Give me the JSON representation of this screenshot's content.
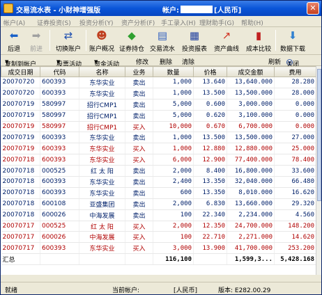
{
  "window": {
    "title": "交易流水表 - 小财神增强版",
    "account_label": "帐户:",
    "account_currency": "[人民币]",
    "close_glyph": "✕"
  },
  "menu": [
    "帐户(A)",
    "证券投资(S)",
    "投资分析(Y)",
    "资产分析(F)",
    "手工录入(H)",
    "理财助手(G)",
    "帮助(H)"
  ],
  "toolbar": {
    "back": "后退",
    "forward": "前进",
    "switch_account": "切换账户",
    "account_overview": "账户概况",
    "holdings": "证券持仓",
    "trade_log": "交易流水",
    "invest_report": "投资报表",
    "asset_curve": "资产曲线",
    "cost_compare": "成本比较",
    "data_download": "数据下载"
  },
  "subbar": {
    "copy_account": "复制到帐户",
    "stock_activity": "股票活动",
    "fund_activity": "资金活动",
    "edit": "修改",
    "delete": "删除",
    "clear": "清除",
    "refresh": "刷新",
    "close": "关闭",
    "dropdown_glyph": "▼"
  },
  "table": {
    "headers": [
      "成交日期",
      "代码",
      "名称",
      "业务",
      "数量",
      "价格",
      "成交金额",
      "费用"
    ],
    "rows": [
      {
        "date": "20070720",
        "code": "600393",
        "name": "东华实业",
        "side": "卖出",
        "qty": "1,000",
        "price": "13.640",
        "amount": "13,640.000",
        "fee": "28.280",
        "type": "sell"
      },
      {
        "date": "20070720",
        "code": "600393",
        "name": "东华实业",
        "side": "卖出",
        "qty": "1,000",
        "price": "13.500",
        "amount": "13,500.000",
        "fee": "28.000",
        "type": "sell"
      },
      {
        "date": "20070719",
        "code": "580997",
        "name": "招行CMP1",
        "side": "卖出",
        "qty": "5,000",
        "price": "0.600",
        "amount": "3,000.000",
        "fee": "0.000",
        "type": "sell"
      },
      {
        "date": "20070719",
        "code": "580997",
        "name": "招行CMP1",
        "side": "卖出",
        "qty": "5,000",
        "price": "0.620",
        "amount": "3,100.000",
        "fee": "0.000",
        "type": "sell"
      },
      {
        "date": "20070719",
        "code": "580997",
        "name": "招行CMP1",
        "side": "买入",
        "qty": "10,000",
        "price": "0.670",
        "amount": "6,700.000",
        "fee": "0.000",
        "type": "buy"
      },
      {
        "date": "20070719",
        "code": "600393",
        "name": "东华实业",
        "side": "卖出",
        "qty": "1,000",
        "price": "13.500",
        "amount": "13,500.000",
        "fee": "27.000",
        "type": "sell"
      },
      {
        "date": "20070719",
        "code": "600393",
        "name": "东华实业",
        "side": "买入",
        "qty": "1,000",
        "price": "12.880",
        "amount": "12,880.000",
        "fee": "25.000",
        "type": "buy"
      },
      {
        "date": "20070718",
        "code": "600393",
        "name": "东华实业",
        "side": "买入",
        "qty": "6,000",
        "price": "12.900",
        "amount": "77,400.000",
        "fee": "78.400",
        "type": "buy"
      },
      {
        "date": "20070718",
        "code": "000525",
        "name": "红 太 阳",
        "side": "卖出",
        "qty": "2,000",
        "price": "8.400",
        "amount": "16,800.000",
        "fee": "33.600",
        "type": "sell"
      },
      {
        "date": "20070718",
        "code": "600393",
        "name": "东华实业",
        "side": "卖出",
        "qty": "2,400",
        "price": "13.350",
        "amount": "32,040.000",
        "fee": "66.480",
        "type": "sell"
      },
      {
        "date": "20070718",
        "code": "600393",
        "name": "东华实业",
        "side": "卖出",
        "qty": "600",
        "price": "13.350",
        "amount": "8,010.000",
        "fee": "16.620",
        "type": "sell"
      },
      {
        "date": "20070718",
        "code": "600108",
        "name": "亚盛集团",
        "side": "卖出",
        "qty": "2,000",
        "price": "6.830",
        "amount": "13,660.000",
        "fee": "29.320",
        "type": "sell"
      },
      {
        "date": "20070718",
        "code": "600026",
        "name": "中海发展",
        "side": "卖出",
        "qty": "100",
        "price": "22.340",
        "amount": "2,234.000",
        "fee": "4.560",
        "type": "sell"
      },
      {
        "date": "20070717",
        "code": "000525",
        "name": "红 太 阳",
        "side": "买入",
        "qty": "2,000",
        "price": "12.350",
        "amount": "24,700.000",
        "fee": "148.200",
        "type": "buy"
      },
      {
        "date": "20070717",
        "code": "600026",
        "name": "中海发展",
        "side": "买入",
        "qty": "100",
        "price": "22.710",
        "amount": "2,271.000",
        "fee": "14.620",
        "type": "buy"
      },
      {
        "date": "20070717",
        "code": "600393",
        "name": "东华实业",
        "side": "买入",
        "qty": "3,000",
        "price": "13.900",
        "amount": "41,700.000",
        "fee": "253.200",
        "type": "buy"
      }
    ],
    "total": {
      "label": "汇总",
      "qty": "116,100",
      "amount": "1,599,3...",
      "fee": "5,428.168"
    }
  },
  "status": {
    "ready": "就绪",
    "current_account_label": "当前帐户:",
    "currency": "[人民币]",
    "version": "版本: E282.00.29"
  },
  "colors": {
    "sell_text": "#00206a",
    "buy_text": "#b00000",
    "titlebar": "#0a55d8"
  }
}
